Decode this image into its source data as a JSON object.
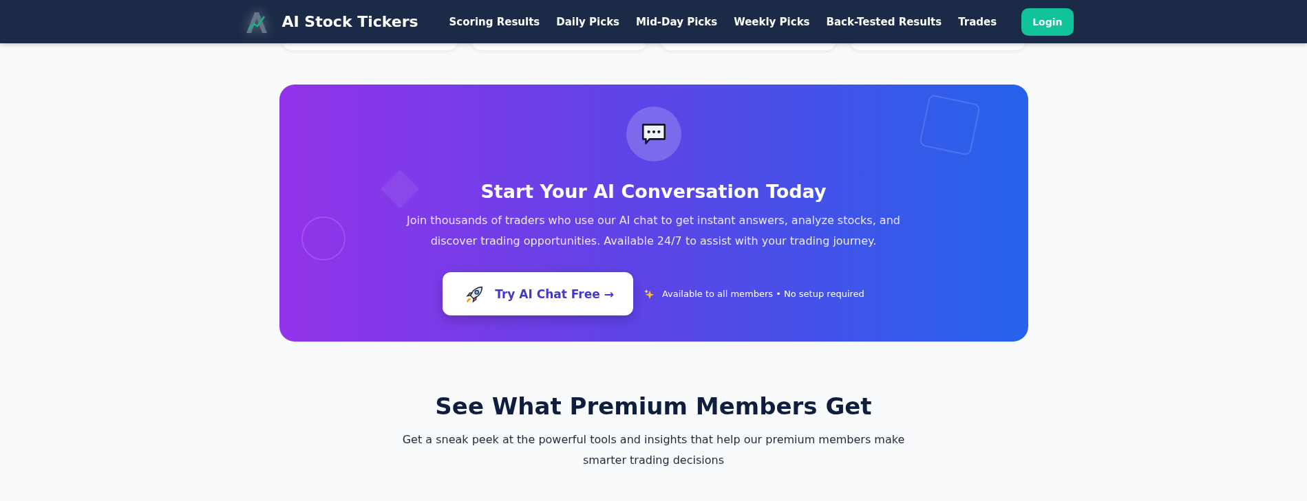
{
  "navbar": {
    "brand": "AI Stock Tickers",
    "links": [
      {
        "label": "Scoring Results"
      },
      {
        "label": "Daily Picks"
      },
      {
        "label": "Mid-Day Picks"
      },
      {
        "label": "Weekly Picks"
      },
      {
        "label": "Back-Tested Results"
      },
      {
        "label": "Trades"
      }
    ],
    "login_button": "Login"
  },
  "cta_banner": {
    "title": "Start Your AI Conversation Today",
    "description": "Join thousands of traders who use our AI chat to get instant answers, analyze stocks, and discover trading opportunities. Available 24/7 to assist with your trading journey.",
    "button": "Try AI Chat Free →",
    "note": "Available to all members • No setup required"
  },
  "premium_section": {
    "title": "See What Premium Members Get",
    "subtitle": "Get a sneak peek at the powerful tools and insights that help our premium members make smarter trading decisions"
  }
}
